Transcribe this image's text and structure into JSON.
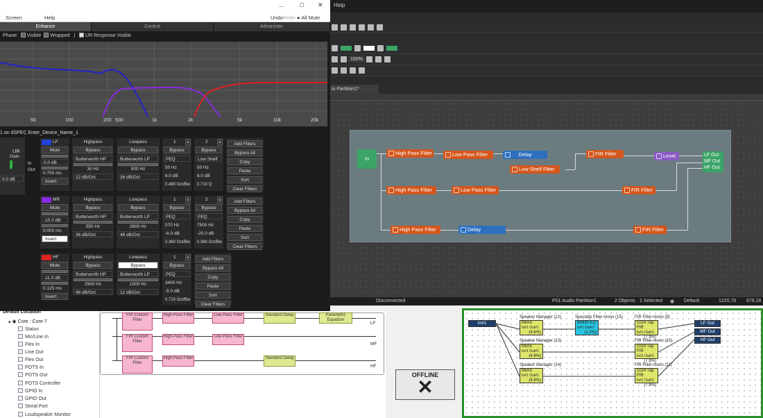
{
  "designer": {
    "menu_help": "Help",
    "zoom": "100%",
    "tab_name": "io Partition1*",
    "blocks": {
      "in": "In",
      "hpf1": "High Pass Filter",
      "lpf1": "Low Pass Filter",
      "delay1": "Delay",
      "shelf": "Low Shelf Filter",
      "fir1": "FIR Filter",
      "level": "Level",
      "lfout": "LF Out",
      "mfout": "MF Out",
      "hfout": "HF Out",
      "hpf2": "High Pass Filter",
      "lpf2": "Low Pass Filter",
      "fir2": "FIR Filter",
      "hpf3": "High Pass Filter",
      "delay3": "Delay",
      "fir3": "FIR Filter"
    },
    "status": {
      "connection": "Disconnected",
      "partition": "P01:Audio Partition1",
      "objects": "2 Objects",
      "selected": "1 Selected",
      "default": "Default",
      "coord1": "1220,70",
      "coord2": "978,28"
    }
  },
  "control": {
    "menu_screen": "Screen",
    "menu_help": "Help",
    "undo": "Undo",
    "redo": "Redo",
    "all_mute": "All Mute",
    "tabs": [
      "Enhance",
      "Control",
      "Administer"
    ],
    "phase": {
      "label": "Phase:",
      "visible": "Visible",
      "wrapped": "Wrapped",
      "ur": "UR Response Visible"
    },
    "freq_ticks": [
      "50",
      "100",
      "200",
      "500",
      "1k",
      "2k",
      "5k",
      "10k",
      "20k"
    ],
    "chain_name": "1 on dSPEC Enter_Device_Name_1",
    "ur": {
      "title": "UR",
      "gain": "Gain",
      "gain_val": "0.0 dB",
      "in": "In",
      "out": "Out"
    },
    "bands": [
      {
        "name": "LF",
        "mute": "Mute",
        "gain": "0.0 dB",
        "delay": "0.750 ms",
        "invert": "Invert",
        "hp": {
          "title": "Highpass",
          "bypass": "Bypass",
          "type": "Butterworth HP",
          "freq": "30 Hz",
          "slope": "12 dB/Oct"
        },
        "lp": {
          "title": "Lowpass",
          "bypass": "Bypass",
          "type": "Butterworth LP",
          "freq": "500 Hz",
          "slope": "36 dB/Oct"
        },
        "peq1": {
          "num": "1",
          "bypass": "Bypass",
          "type": "PEQ",
          "freq": "50 Hz",
          "gain": "6.0 dB",
          "bw": "0.480 Oct/Bw"
        },
        "peq2": {
          "num": "2",
          "bypass": "Bypass",
          "type": "Low Shelf",
          "freq": "50 Hz",
          "gain": "6.0 dB",
          "bw": "0.710 Q"
        },
        "actions": [
          "Add Filters",
          "Bypass All",
          "Copy",
          "Paste",
          "Sort",
          "Clear Filters"
        ]
      },
      {
        "name": "MR",
        "mute": "Mute",
        "gain": "-10.0 dB",
        "delay": "0.000 ms",
        "invert": "Invert",
        "hp": {
          "title": "Highpass",
          "bypass": "Bypass",
          "type": "Butterworth HP",
          "freq": "550 Hz",
          "slope": "36 dB/Oct"
        },
        "lp": {
          "title": "Lowpass",
          "bypass": "Bypass",
          "type": "Butterworth LP",
          "freq": "2600 Hz",
          "slope": "48 dB/Oct"
        },
        "peq1": {
          "num": "1",
          "bypass": "Bypass",
          "type": "PEQ",
          "freq": "570 Hz",
          "gain": "-6.0 dB",
          "bw": "0.360 Oct/Bw"
        },
        "peq2": {
          "num": "2",
          "bypass": "Bypass",
          "type": "PEQ",
          "freq": "7500 Hz",
          "gain": "-20.0 dB",
          "bw": "0.360 Oct/Bw"
        },
        "actions": [
          "Add Filters",
          "Bypass All",
          "Copy",
          "Paste",
          "Sort",
          "Clear Filters"
        ]
      },
      {
        "name": "HF",
        "mute": "Mute",
        "gain": "-11.0 dB",
        "delay": "0.125 ms",
        "invert": "Invert",
        "hp": {
          "title": "Highpass",
          "bypass": "Bypass",
          "type": "Butterworth HP",
          "freq": "2900 Hz",
          "slope": "48 dB/Oct"
        },
        "lp": {
          "title": "Lowpass",
          "bypass": "Bypass",
          "type": "Butterworth LP",
          "freq": "1000 Hz",
          "slope": "12 dB/Oct"
        },
        "peq1": {
          "num": "1",
          "bypass": "Bypass",
          "type": "PEQ",
          "freq": "3400 Hz",
          "gain": "-5.0 dB",
          "bw": "0.710 Oct/Bw"
        },
        "actions": [
          "Add Filters",
          "Bypass All",
          "Copy",
          "Paste",
          "Sort",
          "Clear Filters"
        ]
      }
    ]
  },
  "tree": {
    "header": "Default Location",
    "core": "Core : Core-7",
    "items": [
      "Status",
      "Mic/Line In",
      "Flex In",
      "Line Out",
      "Flex Out",
      "POTS In",
      "POTS Out",
      "POTS Controller",
      "GPIO In",
      "GPIO Out",
      "Serial Port",
      "Loudspeaker Monitor"
    ]
  },
  "schematic_left": {
    "rows": [
      {
        "blocks": [
          "FIR Custom Filter",
          "High-Pass Filter",
          "Low-Pass Filter",
          "Standard Delay",
          "Parametric Equalizer"
        ],
        "out": "LF"
      },
      {
        "blocks": [
          "FIR Custom Filter",
          "High-Pass Filter",
          "Low-Pass Filter"
        ],
        "out": "MF"
      },
      {
        "blocks": [
          "FIR Custom Filter",
          "High-Pass Filter",
          "Standard Delay"
        ],
        "out": "HF"
      }
    ]
  },
  "offline": "OFFLINE",
  "schematic_right": {
    "in": "In#1",
    "sm": [
      {
        "title": "Speaker Manager (12)",
        "body": "Mono",
        "io": "In#1 Out#1",
        "val": "(4.6%)"
      },
      {
        "title": "Speaker Manager (13)",
        "body": "Mono",
        "io": "In#1 Out#1",
        "val": "(4.6%)"
      },
      {
        "title": "Speaker Manager (14)",
        "body": "Mono",
        "io": "In#1 Out#1",
        "val": "(4.6%)"
      }
    ],
    "spec": {
      "title": "Specialty Filter-mono (15)",
      "body": "British EQ",
      "io": "In#1 Out#1",
      "val": "(1.2%)"
    },
    "fir": [
      {
        "title": "FIR Filter-mono (9)",
        "body": "1024 Tap FIR",
        "io": "In#1 Out#1",
        "val": "(7.9%)"
      },
      {
        "title": "FIR Filter-mono (10)",
        "body": "1024 Tap FIR",
        "io": "In#1 Out#1",
        "val": "(7.9%)"
      },
      {
        "title": "FIR Filter-mono (11)",
        "body": "1024 Tap FIR",
        "io": "In#1 Out#1",
        "val": "(7.9%)"
      }
    ],
    "outs": [
      "LF Out",
      "MF Out",
      "HF Out"
    ]
  }
}
